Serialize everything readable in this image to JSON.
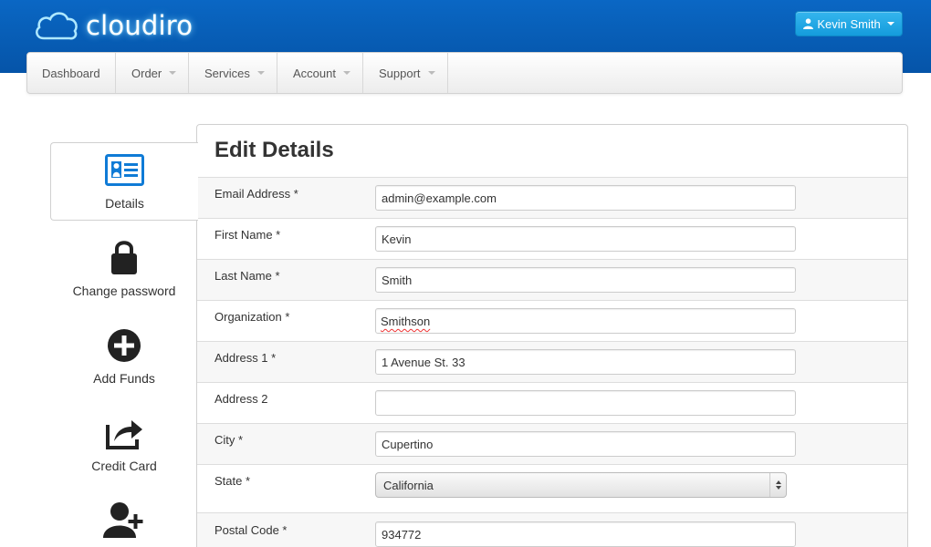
{
  "header": {
    "brand": "cloudiro",
    "user_name": "Kevin Smith"
  },
  "nav": {
    "items": [
      {
        "label": "Dashboard",
        "dropdown": false
      },
      {
        "label": "Order",
        "dropdown": true
      },
      {
        "label": "Services",
        "dropdown": true
      },
      {
        "label": "Account",
        "dropdown": true
      },
      {
        "label": "Support",
        "dropdown": true
      }
    ]
  },
  "sidebar": {
    "items": [
      {
        "label": "Details",
        "icon": "id-card-icon",
        "active": true
      },
      {
        "label": "Change password",
        "icon": "lock-icon",
        "active": false
      },
      {
        "label": "Add Funds",
        "icon": "plus-circle-icon",
        "active": false
      },
      {
        "label": "Credit Card",
        "icon": "share-icon",
        "active": false
      },
      {
        "label": "",
        "icon": "add-user-icon",
        "active": false
      }
    ]
  },
  "form": {
    "title": "Edit Details",
    "fields": {
      "email": {
        "label": "Email Address *",
        "value": "admin@example.com"
      },
      "first_name": {
        "label": "First Name *",
        "value": "Kevin"
      },
      "last_name": {
        "label": "Last Name *",
        "value": "Smith"
      },
      "organization": {
        "label": "Organization *",
        "value": "Smithson"
      },
      "address1": {
        "label": "Address 1 *",
        "value": "1 Avenue St. 33"
      },
      "address2": {
        "label": "Address 2",
        "value": ""
      },
      "city": {
        "label": "City *",
        "value": "Cupertino"
      },
      "state": {
        "label": "State *",
        "value": "California"
      },
      "postal_code": {
        "label": "Postal Code *",
        "value": "934772"
      }
    }
  },
  "colors": {
    "header_blue": "#0660be",
    "user_button": "#1fa6e3",
    "icon_blue": "#0f7bd6",
    "icon_dark": "#222222"
  }
}
